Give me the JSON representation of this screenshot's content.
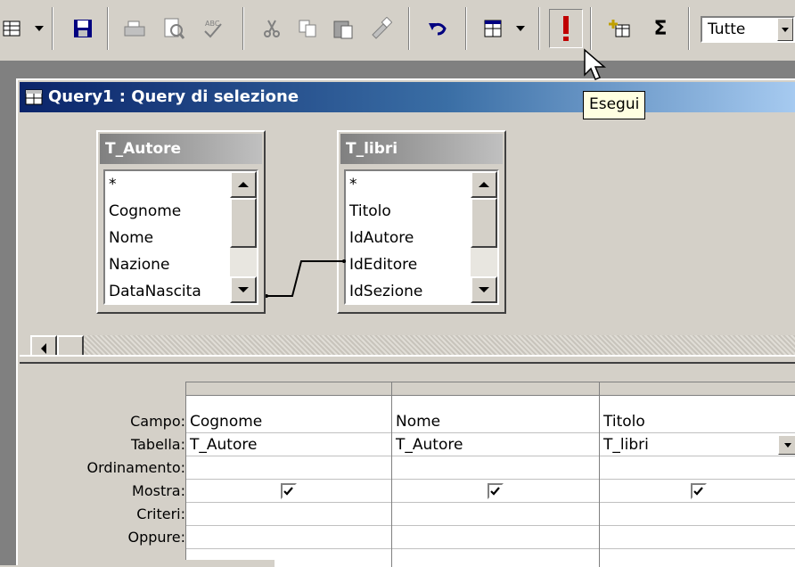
{
  "toolbar": {
    "combo_value": "Tutte",
    "tooltip": "Esegui"
  },
  "window": {
    "title": "Query1 : Query di selezione"
  },
  "tables": [
    {
      "name": "T_Autore",
      "fields": [
        "*",
        "Cognome",
        "Nome",
        "Nazione",
        "DataNascita"
      ]
    },
    {
      "name": "T_libri",
      "fields": [
        "*",
        "Titolo",
        "IdAutore",
        "IdEditore",
        "IdSezione"
      ]
    }
  ],
  "grid": {
    "row_labels": [
      "Campo:",
      "Tabella:",
      "Ordinamento:",
      "Mostra:",
      "Criteri:",
      "Oppure:"
    ],
    "columns": [
      {
        "campo": "Cognome",
        "tabella": "T_Autore",
        "mostra": true
      },
      {
        "campo": "Nome",
        "tabella": "T_Autore",
        "mostra": true
      },
      {
        "campo": "Titolo",
        "tabella": "T_libri",
        "mostra": true
      }
    ]
  }
}
